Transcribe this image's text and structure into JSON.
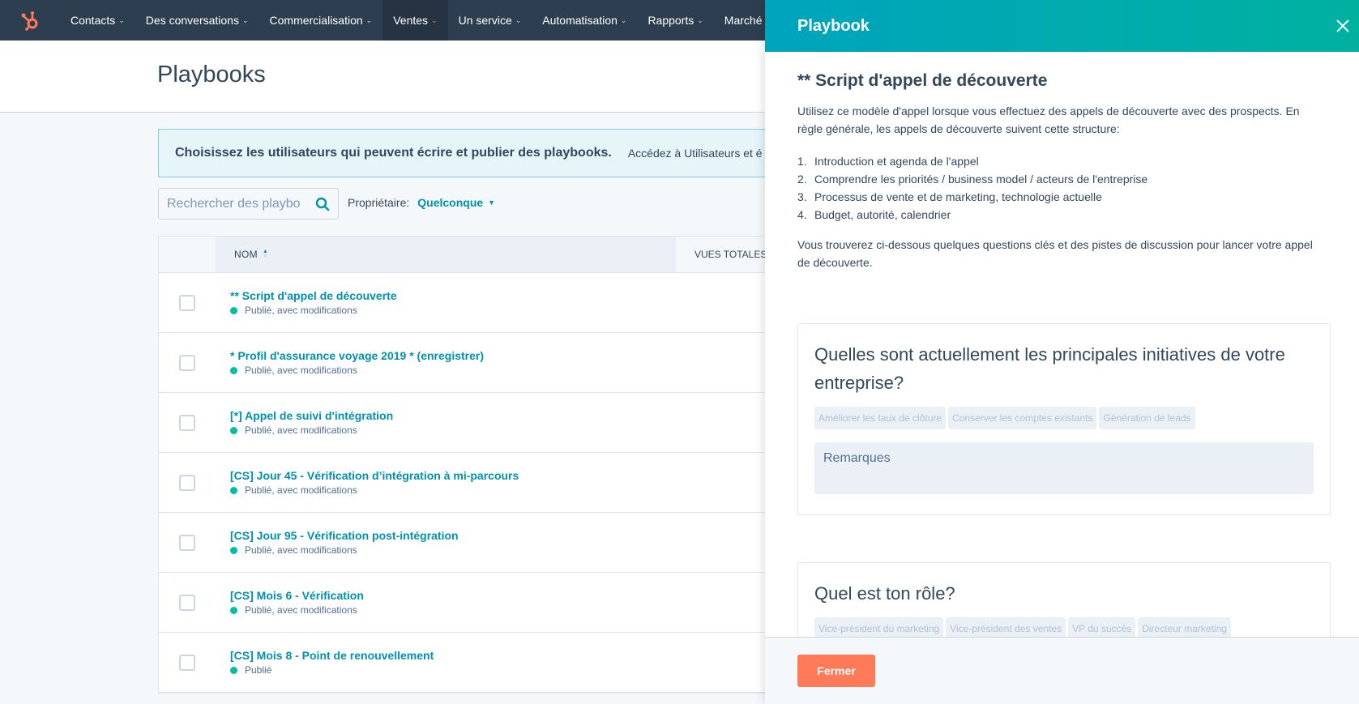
{
  "nav": {
    "logo": "hubspot-sprocket-icon",
    "items": [
      {
        "label": "Contacts",
        "active": false
      },
      {
        "label": "Des conversations",
        "active": false
      },
      {
        "label": "Commercialisation",
        "active": false
      },
      {
        "label": "Ventes",
        "active": true
      },
      {
        "label": "Un service",
        "active": false
      },
      {
        "label": "Automatisation",
        "active": false
      },
      {
        "label": "Rapports",
        "active": false
      },
      {
        "label": "Marché des ac",
        "active": false
      }
    ]
  },
  "page": {
    "title": "Playbooks",
    "banner": {
      "strong": "Choisissez les utilisateurs qui peuvent écrire et publier des playbooks.",
      "link": "Accédez à Utilisateurs et é"
    },
    "search": {
      "placeholder": "Rechercher des playbooks",
      "value": ""
    },
    "owner": {
      "label": "Propriétaire:",
      "value": "Quelconque"
    },
    "table": {
      "columns": [
        "NOM",
        "VUES TOTALES"
      ],
      "rows": [
        {
          "title": "** Script d'appel de découverte",
          "status": "Publié, avec modifications"
        },
        {
          "title": "* Profil d'assurance voyage 2019 * (enregistrer)",
          "status": "Publié, avec modifications"
        },
        {
          "title": "[*] Appel de suivi d'intégration",
          "status": "Publié, avec modifications"
        },
        {
          "title": "[CS] Jour 45 - Vérification d’intégration à mi-parcours",
          "status": "Publié, avec modifications"
        },
        {
          "title": "[CS] Jour 95 - Vérification post-intégration",
          "status": "Publié, avec modifications"
        },
        {
          "title": "[CS] Mois 6 - Vérification",
          "status": "Publié, avec modifications"
        },
        {
          "title": "[CS] Mois 8 - Point de renouvellement",
          "status": "Publié"
        }
      ]
    }
  },
  "panel": {
    "header": "Playbook",
    "title": "** Script d'appel de découverte",
    "intro": "Utilisez ce modèle d'appel lorsque vous effectuez des appels de découverte avec des prospects. En règle générale, les appels de découverte suivent cette structure:",
    "steps": [
      {
        "num": "1.",
        "text": "Introduction et agenda de l'appel"
      },
      {
        "num": "2.",
        "text": "Comprendre les priorités / business model / acteurs de l'entreprise"
      },
      {
        "num": "3.",
        "text": "Processus de vente et de marketing, technologie actuelle"
      },
      {
        "num": "4.",
        "text": "Budget, autorité, calendrier"
      }
    ],
    "outro": "Vous trouverez ci-dessous quelques questions clés et des pistes de discussion pour lancer votre appel de découverte.",
    "questions": [
      {
        "question": "Quelles sont actuellement les principales initiatives de votre entreprise?",
        "tags": [
          "Améliorer les taux de clôture",
          "Conserver les comptes existants",
          "Génération de leads"
        ],
        "notes_placeholder": "Remarques"
      },
      {
        "question": "Quel est ton rôle?",
        "tags": [
          "Vice-président du marketing",
          "Vice-président des ventes",
          "VP du succès",
          "Directeur marketing"
        ]
      }
    ],
    "footer": {
      "close_label": "Fermer"
    }
  },
  "colors": {
    "nav_bg": "#2d3e50",
    "accent": "#ff7a59",
    "link": "#0091ae",
    "status_published": "#00bda5",
    "panel_header_start": "#00a4bd",
    "panel_header_end": "#00b1a0"
  }
}
